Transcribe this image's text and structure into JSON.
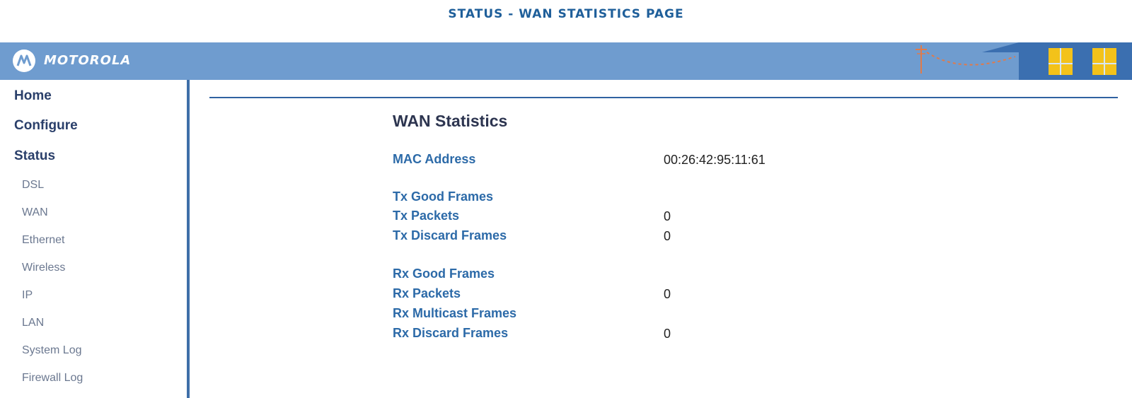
{
  "caption": "STATUS - WAN STATISTICS PAGE",
  "header": {
    "brand": "MOTOROLA",
    "logo_icon": "motorola-batwing-icon",
    "colors": {
      "bar": "#6f9ccf",
      "house_wall": "#3b6fb0",
      "window": "#f3c21a"
    }
  },
  "sidebar": {
    "main": [
      {
        "label": "Home"
      },
      {
        "label": "Configure"
      },
      {
        "label": "Status"
      }
    ],
    "sub": [
      {
        "label": "DSL"
      },
      {
        "label": "WAN"
      },
      {
        "label": "Ethernet"
      },
      {
        "label": "Wireless"
      },
      {
        "label": "IP"
      },
      {
        "label": "LAN"
      },
      {
        "label": "System Log"
      },
      {
        "label": "Firewall Log"
      }
    ]
  },
  "main": {
    "title": "WAN Statistics",
    "rows": [
      {
        "label": "MAC Address",
        "value": "00:26:42:95:11:61"
      },
      {
        "label": "Tx Good Frames",
        "value": ""
      },
      {
        "label": "Tx Packets",
        "value": "0"
      },
      {
        "label": "Tx Discard Frames",
        "value": "0"
      },
      {
        "label": "Rx Good Frames",
        "value": ""
      },
      {
        "label": "Rx Packets",
        "value": "0"
      },
      {
        "label": "Rx Multicast Frames",
        "value": ""
      },
      {
        "label": "Rx Discard Frames",
        "value": "0"
      }
    ]
  }
}
